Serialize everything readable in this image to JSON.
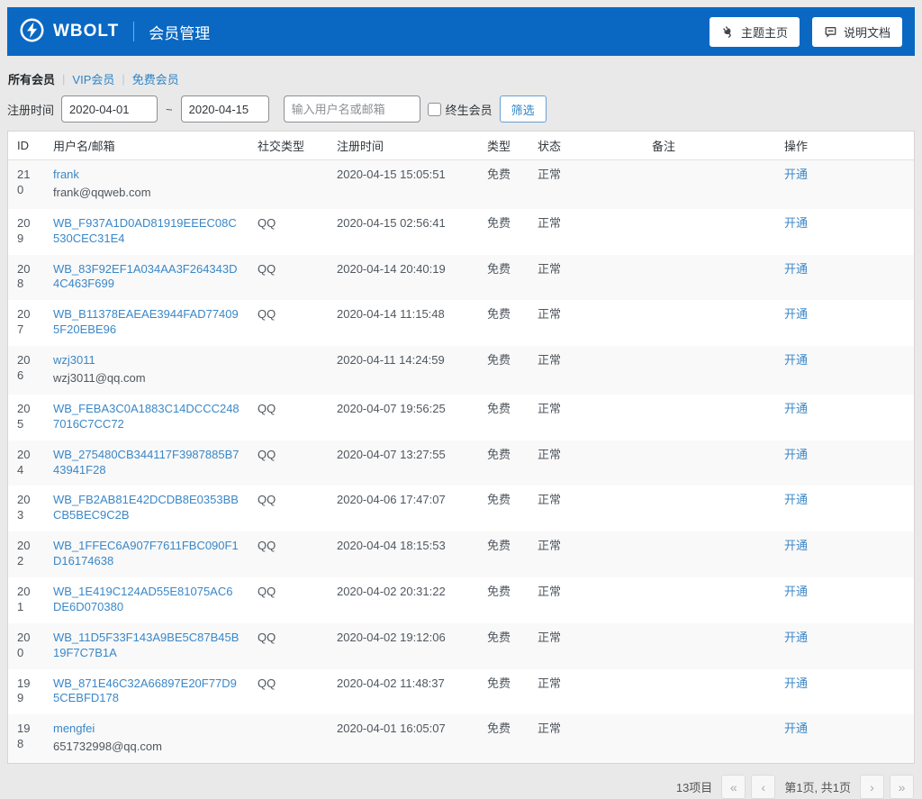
{
  "header": {
    "brand": "WBOLT",
    "page_title": "会员管理",
    "theme_home_button": "主题主页",
    "docs_button": "说明文档"
  },
  "tabs": {
    "all": "所有会员",
    "vip": "VIP会员",
    "free": "免费会员",
    "separator": "|"
  },
  "filters": {
    "reg_time_label": "注册时间",
    "date_from": "2020-04-01",
    "date_separator": "~",
    "date_to": "2020-04-15",
    "search_placeholder": "输入用户名或邮箱",
    "lifetime_label": "终生会员",
    "filter_button": "筛选"
  },
  "table": {
    "columns": [
      "ID",
      "用户名/邮箱",
      "社交类型",
      "注册时间",
      "类型",
      "状态",
      "备注",
      "操作"
    ],
    "rows": [
      {
        "id": "210",
        "username": "frank",
        "email": "frank@qqweb.com",
        "social": "",
        "reg_time": "2020-04-15 15:05:51",
        "type": "免费",
        "status": "正常",
        "remark": "",
        "action": "开通"
      },
      {
        "id": "209",
        "username": "WB_F937A1D0AD81919EEEC08C530CEC31E4",
        "email": "",
        "social": "QQ",
        "reg_time": "2020-04-15 02:56:41",
        "type": "免费",
        "status": "正常",
        "remark": "",
        "action": "开通"
      },
      {
        "id": "208",
        "username": "WB_83F92EF1A034AA3F264343D4C463F699",
        "email": "",
        "social": "QQ",
        "reg_time": "2020-04-14 20:40:19",
        "type": "免费",
        "status": "正常",
        "remark": "",
        "action": "开通"
      },
      {
        "id": "207",
        "username": "WB_B11378EAEAE3944FAD774095F20EBE96",
        "email": "",
        "social": "QQ",
        "reg_time": "2020-04-14 11:15:48",
        "type": "免费",
        "status": "正常",
        "remark": "",
        "action": "开通"
      },
      {
        "id": "206",
        "username": "wzj3011",
        "email": "wzj3011@qq.com",
        "social": "",
        "reg_time": "2020-04-11 14:24:59",
        "type": "免费",
        "status": "正常",
        "remark": "",
        "action": "开通"
      },
      {
        "id": "205",
        "username": "WB_FEBA3C0A1883C14DCCC2487016C7CC72",
        "email": "",
        "social": "QQ",
        "reg_time": "2020-04-07 19:56:25",
        "type": "免费",
        "status": "正常",
        "remark": "",
        "action": "开通"
      },
      {
        "id": "204",
        "username": "WB_275480CB344117F3987885B743941F28",
        "email": "",
        "social": "QQ",
        "reg_time": "2020-04-07 13:27:55",
        "type": "免费",
        "status": "正常",
        "remark": "",
        "action": "开通"
      },
      {
        "id": "203",
        "username": "WB_FB2AB81E42DCDB8E0353BBCB5BEC9C2B",
        "email": "",
        "social": "QQ",
        "reg_time": "2020-04-06 17:47:07",
        "type": "免费",
        "status": "正常",
        "remark": "",
        "action": "开通"
      },
      {
        "id": "202",
        "username": "WB_1FFEC6A907F7611FBC090F1D16174638",
        "email": "",
        "social": "QQ",
        "reg_time": "2020-04-04 18:15:53",
        "type": "免费",
        "status": "正常",
        "remark": "",
        "action": "开通"
      },
      {
        "id": "201",
        "username": "WB_1E419C124AD55E81075AC6DE6D070380",
        "email": "",
        "social": "QQ",
        "reg_time": "2020-04-02 20:31:22",
        "type": "免费",
        "status": "正常",
        "remark": "",
        "action": "开通"
      },
      {
        "id": "200",
        "username": "WB_11D5F33F143A9BE5C87B45B19F7C7B1A",
        "email": "",
        "social": "QQ",
        "reg_time": "2020-04-02 19:12:06",
        "type": "免费",
        "status": "正常",
        "remark": "",
        "action": "开通"
      },
      {
        "id": "199",
        "username": "WB_871E46C32A66897E20F77D95CEBFD178",
        "email": "",
        "social": "QQ",
        "reg_time": "2020-04-02 11:48:37",
        "type": "免费",
        "status": "正常",
        "remark": "",
        "action": "开通"
      },
      {
        "id": "198",
        "username": "mengfei",
        "email": "651732998@qq.com",
        "social": "",
        "reg_time": "2020-04-01 16:05:07",
        "type": "免费",
        "status": "正常",
        "remark": "",
        "action": "开通"
      }
    ]
  },
  "pagination": {
    "total_text": "13项目",
    "first": "«",
    "prev": "‹",
    "page_info": "第1页, 共1页",
    "next": "›",
    "last": "»"
  },
  "colors": {
    "header_bg": "#0a68c3",
    "table_link": "#3a87c8",
    "tab_link": "#2e84c6",
    "row_stripe": "#f9f9f9"
  }
}
